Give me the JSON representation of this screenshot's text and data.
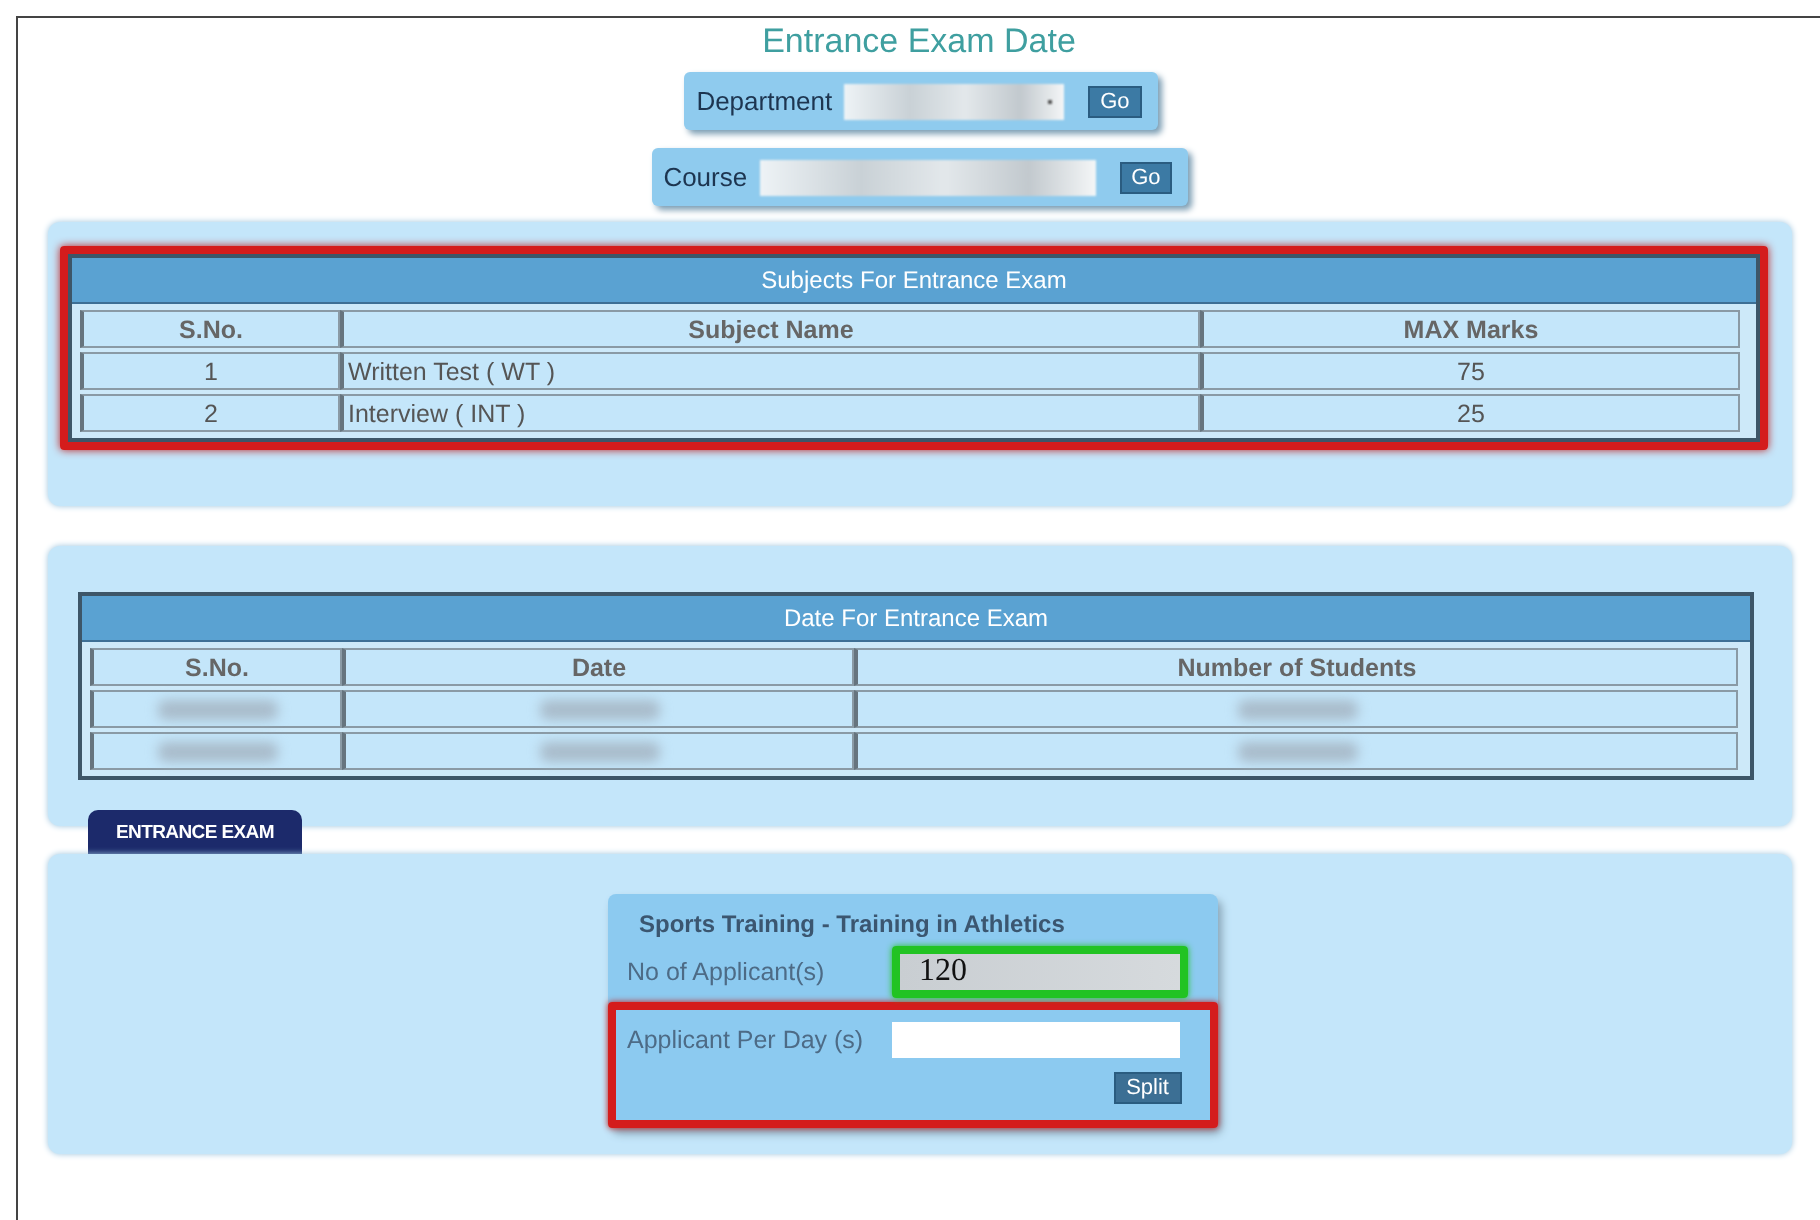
{
  "page_title": "Entrance Exam Date",
  "selectors": [
    {
      "label": "Department",
      "button": "Go",
      "has_dropdown": true
    },
    {
      "label": "Course",
      "button": "Go",
      "has_dropdown": false
    }
  ],
  "subjects_table": {
    "title": "Subjects For Entrance Exam",
    "highlighted": true,
    "columns": [
      "S.No.",
      "Subject Name",
      "MAX Marks"
    ],
    "rows": [
      {
        "kind": "text",
        "cells": [
          "1",
          "Written Test ( WT )",
          "75"
        ]
      },
      {
        "kind": "text",
        "cells": [
          "2",
          "Interview ( INT )",
          "25"
        ]
      }
    ]
  },
  "dates_table": {
    "title": "Date For Entrance Exam",
    "highlighted": false,
    "columns": [
      "S.No.",
      "Date",
      "Number of Students"
    ],
    "rows": [
      {
        "kind": "blurred"
      },
      {
        "kind": "blurred"
      }
    ]
  },
  "tabs": [
    {
      "label": "ENTRANCE EXAM",
      "selected": true
    }
  ],
  "form": {
    "title": "Sports Training - Training in Athletics",
    "fields": [
      {
        "label": "No of Applicant(s)",
        "value": "120",
        "highlighted": true
      },
      {
        "label": "Applicant Per Day (s)",
        "highlighted": true
      }
    ],
    "button": "Split"
  }
}
